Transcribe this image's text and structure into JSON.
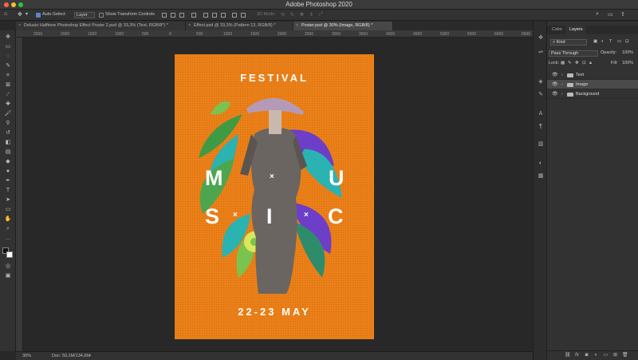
{
  "app": {
    "title": "Adobe Photoshop 2020"
  },
  "options_bar": {
    "auto_select_label": "Auto-Select:",
    "auto_select_value": "Layer",
    "show_transform_label": "Show Transform Controls",
    "mode_3d_label": "3D Mode:"
  },
  "doc_tabs": [
    {
      "label": "Delusio Halftone Photoshop Effect Poster 2.psd @ 33,3% (Text, RGB/8*) *"
    },
    {
      "label": "Effect.psd @ 33,3% (Pattern 13, RGB/8) *"
    },
    {
      "label": "Poster.psd @ 30% (Image, RGB/8) *"
    }
  ],
  "ruler": {
    "ticks": [
      "2500",
      "2000",
      "1500",
      "1000",
      "500",
      "0",
      "500",
      "1000",
      "1500",
      "2000",
      "2500",
      "3000",
      "3500",
      "4000",
      "4500",
      "5000",
      "5500",
      "6000",
      "6500"
    ]
  },
  "status": {
    "zoom": "30%",
    "doc_info": "Doc: 50,1M/134,6M"
  },
  "poster": {
    "title": "FESTIVAL",
    "letters": [
      "M",
      "U",
      "S",
      "I",
      "C"
    ],
    "separator": "×",
    "date": "22-23 MAY",
    "colors": {
      "background": "#ec8119",
      "text": "#ffffff",
      "leaf_green": "#3f9a44",
      "leaf_teal": "#2ab3b0",
      "leaf_purple": "#6d3ec7",
      "statue": "#6a6560"
    }
  },
  "layers_panel": {
    "tabs": [
      "Color",
      "Layers"
    ],
    "active_tab": "Layers",
    "filter_kind": "Kind",
    "blend_mode": "Pass Through",
    "opacity_label": "Opacity:",
    "opacity_value": "100%",
    "lock_label": "Lock:",
    "fill_label": "Fill:",
    "fill_value": "100%",
    "layers": [
      {
        "name": "Text",
        "selected": false
      },
      {
        "name": "Image",
        "selected": true
      },
      {
        "name": "Background",
        "selected": false
      }
    ]
  }
}
